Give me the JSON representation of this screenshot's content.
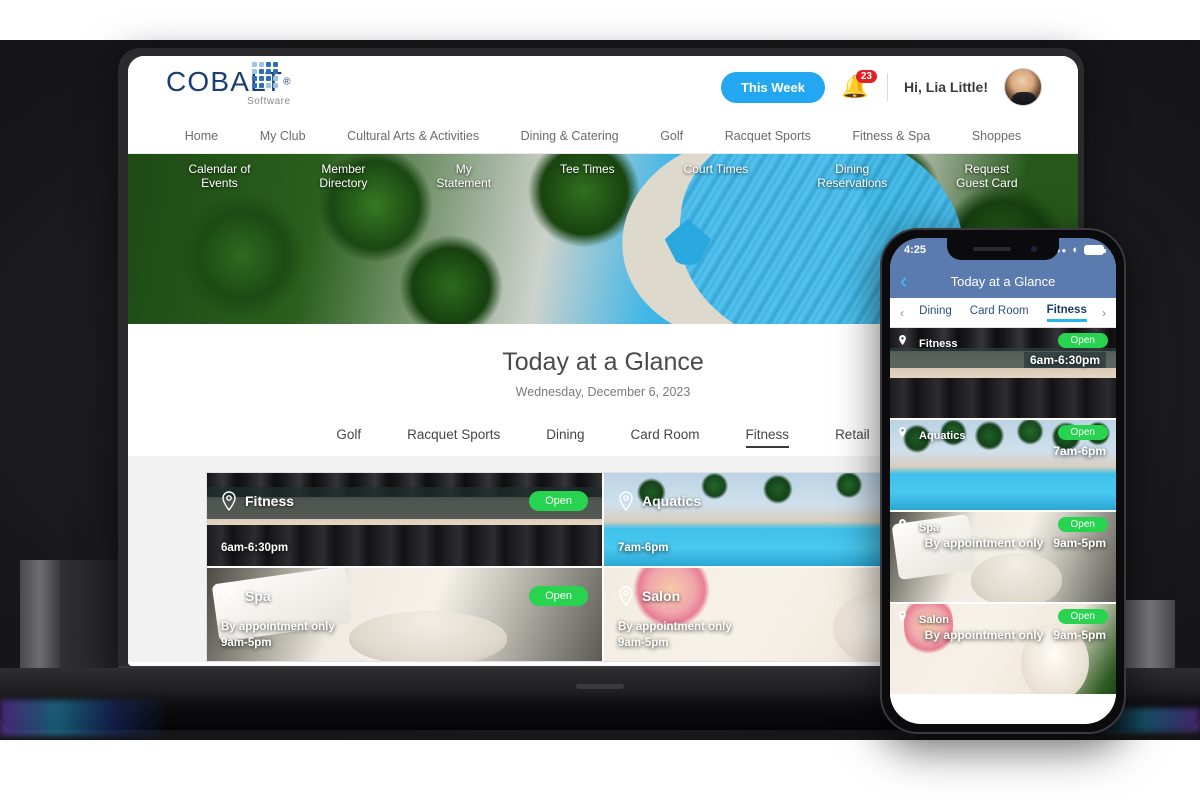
{
  "header": {
    "logo_word": "COBALT",
    "logo_reg": "®",
    "logo_sub": "Software",
    "week_button": "This Week",
    "notification_count": "23",
    "greeting": "Hi, Lia Little!"
  },
  "main_nav": [
    {
      "label": "Home"
    },
    {
      "label": "My Club"
    },
    {
      "label": "Cultural Arts & Activities"
    },
    {
      "label": "Dining & Catering"
    },
    {
      "label": "Golf"
    },
    {
      "label": "Racquet Sports"
    },
    {
      "label": "Fitness & Spa"
    },
    {
      "label": "Shoppes"
    }
  ],
  "hero_nav": [
    {
      "label": "Calendar of\nEvents"
    },
    {
      "label": "Member\nDirectory"
    },
    {
      "label": "My\nStatement"
    },
    {
      "label": "Tee Times"
    },
    {
      "label": "Court Times"
    },
    {
      "label": "Dining\nReservations"
    },
    {
      "label": "Request\nGuest Card"
    }
  ],
  "glance": {
    "title": "Today at a Glance",
    "date": "Wednesday, December 6, 2023",
    "tabs": [
      {
        "label": "Golf",
        "active": false
      },
      {
        "label": "Racquet Sports",
        "active": false
      },
      {
        "label": "Dining",
        "active": false
      },
      {
        "label": "Card Room",
        "active": false
      },
      {
        "label": "Fitness",
        "active": true
      },
      {
        "label": "Retail",
        "active": false
      }
    ]
  },
  "cards": [
    {
      "title": "Fitness",
      "status": "Open",
      "appointment": "",
      "hours": "6am-6:30pm"
    },
    {
      "title": "Aquatics",
      "status": "Open",
      "appointment": "",
      "hours": "7am-6pm"
    },
    {
      "title": "Spa",
      "status": "Open",
      "appointment": "By appointment only",
      "hours": "9am-5pm"
    },
    {
      "title": "Salon",
      "status": "Open",
      "appointment": "By appointment only",
      "hours": "9am-5pm"
    }
  ],
  "phone": {
    "status_time": "4:25",
    "title": "Today at a Glance",
    "tabs": [
      {
        "label": "Dining",
        "active": false
      },
      {
        "label": "Card Room",
        "active": false
      },
      {
        "label": "Fitness",
        "active": true
      }
    ],
    "cards": [
      {
        "title": "Fitness",
        "status": "Open",
        "appointment": "",
        "hours": "6am-6:30pm"
      },
      {
        "title": "Aquatics",
        "status": "Open",
        "appointment": "",
        "hours": "7am-6pm"
      },
      {
        "title": "Spa",
        "status": "Open",
        "appointment": "By appointment only",
        "hours": "9am-5pm"
      },
      {
        "title": "Salon",
        "status": "Open",
        "appointment": "By appointment only",
        "hours": "9am-5pm"
      }
    ]
  },
  "colors": {
    "brand_blue": "#1b3f73",
    "accent_blue": "#23a7f2",
    "badge_red": "#e62020",
    "status_green": "#27d34f",
    "phone_header_blue": "#5b7aad",
    "phone_tab_underline": "#22b7ef"
  }
}
